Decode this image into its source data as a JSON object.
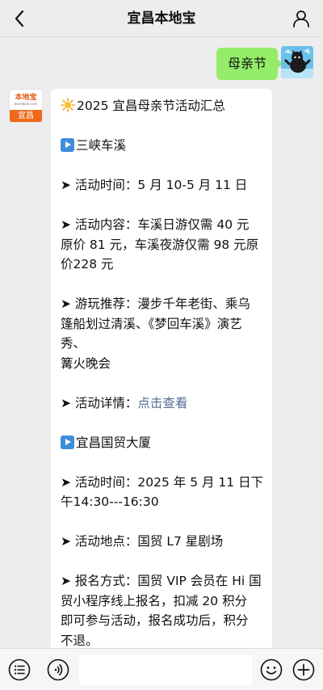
{
  "header": {
    "title": "宜昌本地宝"
  },
  "chat": {
    "outgoing_message": "母亲节",
    "bot_avatar": {
      "logo_text": "本地宝",
      "logo_subtext": "bendibao.com",
      "city_label": "宜昌"
    },
    "reply": {
      "heading": "2025 宜昌母亲节活动汇总",
      "section1_title": "三峡车溪",
      "s1_time": "➤ 活动时间：5 月 10-5 月 11 日",
      "s1_content_1": "➤ 活动内容：车溪日游仅需 40 元",
      "s1_content_2": "原价 81 元，车溪夜游仅需 98 元原",
      "s1_content_3": "价228 元",
      "s1_recommend_1": "➤ 游玩推荐：漫步千年老街、乘乌",
      "s1_recommend_2": "篷船划过清溪、《梦回车溪》演艺秀、",
      "s1_recommend_3": "篝火晚会",
      "s1_detail_prefix": "➤ 活动详情：",
      "s1_detail_link": "点击查看",
      "section2_title": "宜昌国贸大厦",
      "s2_time_1": "➤ 活动时间：2025 年 5 月 11 日下",
      "s2_time_2": "午14:30---16:30",
      "s2_place": "➤ 活动地点：国贸 L7 星剧场",
      "s2_signup_1": "➤ 报名方式：国贸 VIP 会员在 Hi 国",
      "s2_signup_2": "贸小程序线上报名，扣减 20 积分",
      "s2_signup_3": "即可参与活动，报名成功后，积分",
      "s2_signup_4": "不退。"
    }
  },
  "icons": {
    "back": "chevron-left-icon",
    "profile": "person-icon",
    "menu": "list-menu-icon",
    "voice": "voice-icon",
    "emoji": "emoji-icon",
    "add": "plus-circle-icon"
  },
  "colors": {
    "outgoing_bubble": "#95ec69",
    "link": "#576b95",
    "brand_orange": "#ee6a1a"
  }
}
